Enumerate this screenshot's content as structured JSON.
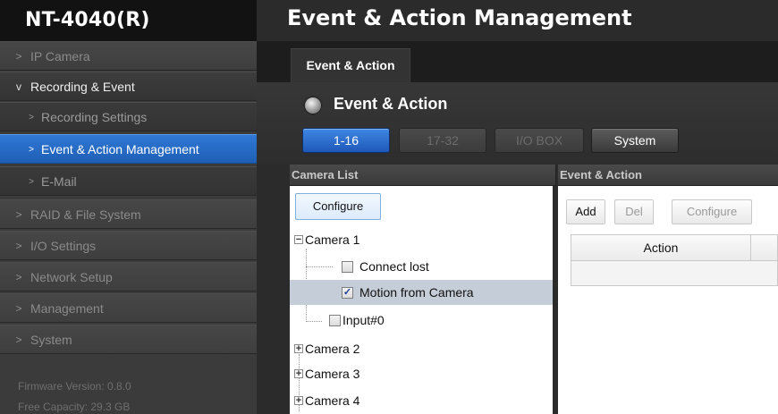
{
  "brand": "NT-4040(R)",
  "sidebar": {
    "items": [
      {
        "label": "IP Camera",
        "chevron": ">"
      },
      {
        "label": "Recording & Event",
        "chevron": "v"
      },
      {
        "label": "Recording Settings",
        "chevron": ">"
      },
      {
        "label": "Event & Action Management",
        "chevron": ">"
      },
      {
        "label": "E-Mail",
        "chevron": ">"
      },
      {
        "label": "RAID & File System",
        "chevron": ">"
      },
      {
        "label": "I/O Settings",
        "chevron": ">"
      },
      {
        "label": "Network Setup",
        "chevron": ">"
      },
      {
        "label": "Management",
        "chevron": ">"
      },
      {
        "label": "System",
        "chevron": ">"
      }
    ],
    "firmware": "Firmware Version: 0.8.0",
    "capacity": "Free Capacity: 29.3 GB"
  },
  "main": {
    "title": "Event & Action Management",
    "tab": "Event & Action",
    "section_title": "Event & Action",
    "segments": [
      "1-16",
      "17-32",
      "I/O BOX",
      "System"
    ]
  },
  "camera_list": {
    "header": "Camera List",
    "configure": "Configure",
    "tree": [
      {
        "label": "Camera 1",
        "expander": "−"
      },
      {
        "label": "Connect lost",
        "checked": false
      },
      {
        "label": "Motion from Camera",
        "checked": true
      },
      {
        "label": "Input#0",
        "checked": false
      },
      {
        "label": "Camera 2",
        "expander": "+"
      },
      {
        "label": "Camera 3",
        "expander": "+"
      },
      {
        "label": "Camera 4",
        "expander": "+"
      }
    ],
    "check_mark": "✓"
  },
  "event_action": {
    "header": "Event & Action",
    "buttons": [
      "Add",
      "Del",
      "Configure"
    ],
    "columns": [
      "Action"
    ]
  },
  "colors": {
    "active_blue": "#2a6fcf",
    "sidebar_bg": "#3b3b3b",
    "brand_bg": "#121212",
    "tree_highlight": "#c5cdd8"
  }
}
